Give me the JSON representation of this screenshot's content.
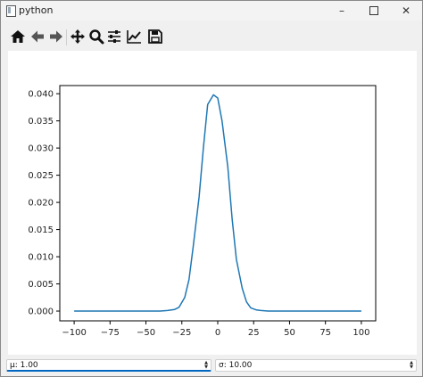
{
  "window": {
    "title": "python"
  },
  "toolbar": {
    "buttons": [
      {
        "name": "home-icon"
      },
      {
        "name": "back-arrow-icon"
      },
      {
        "name": "forward-arrow-icon"
      },
      {
        "name": "pan-icon"
      },
      {
        "name": "zoom-icon"
      },
      {
        "name": "configure-subplots-icon"
      },
      {
        "name": "edit-axis-icon"
      },
      {
        "name": "save-icon"
      }
    ]
  },
  "controls": {
    "mu": {
      "value": "µ: 1.00"
    },
    "sigma": {
      "value": "σ: 10.00"
    }
  },
  "chart_data": {
    "type": "line",
    "title": "",
    "xlabel": "",
    "ylabel": "",
    "xlim": [
      -110,
      110
    ],
    "ylim": [
      -0.0018,
      0.0415
    ],
    "xticks": [
      "−100",
      "−75",
      "−50",
      "−25",
      "0",
      "25",
      "50",
      "75",
      "100"
    ],
    "xtick_values": [
      -100,
      -75,
      -50,
      -25,
      0,
      25,
      50,
      75,
      100
    ],
    "yticks": [
      "0.000",
      "0.005",
      "0.010",
      "0.015",
      "0.020",
      "0.025",
      "0.030",
      "0.035",
      "0.040"
    ],
    "ytick_values": [
      0,
      0.005,
      0.01,
      0.015,
      0.02,
      0.025,
      0.03,
      0.035,
      0.04
    ],
    "grid": false,
    "series": [
      {
        "color": "#1f77b4",
        "x": [
          -100,
          -40,
          -35,
          -30,
          -27,
          -23,
          -20,
          -17,
          -13,
          -10,
          -7,
          -3,
          0,
          3,
          7,
          10,
          13,
          17,
          20,
          23,
          27,
          30,
          35,
          40,
          100
        ],
        "y": [
          0.0,
          0.0,
          0.0001,
          0.0003,
          0.0007,
          0.0025,
          0.0058,
          0.012,
          0.021,
          0.03,
          0.038,
          0.0398,
          0.0392,
          0.035,
          0.0265,
          0.017,
          0.0095,
          0.0042,
          0.0017,
          0.0006,
          0.0002,
          0.0001,
          0.0,
          0.0,
          0.0
        ]
      }
    ]
  }
}
